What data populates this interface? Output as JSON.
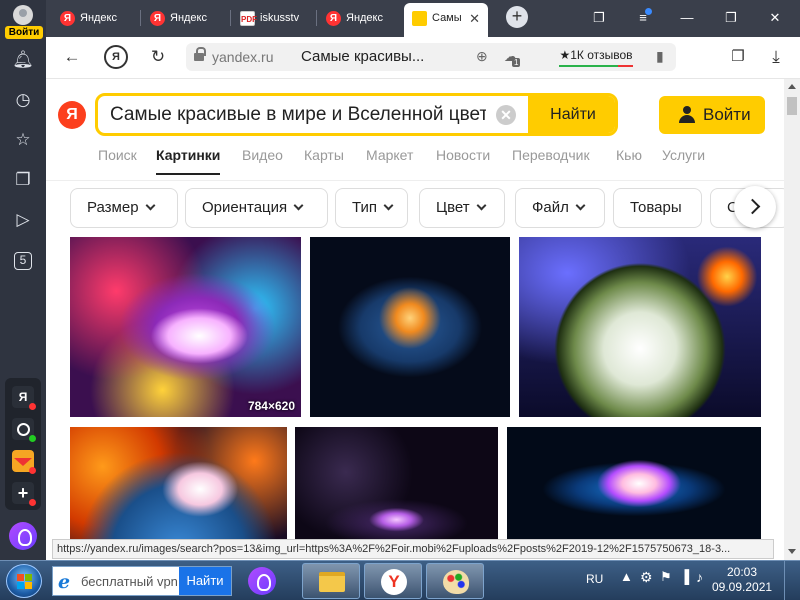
{
  "sidebar": {
    "login_label": "Войти",
    "icons": [
      "bell-icon",
      "history-icon",
      "star-icon",
      "collections-icon",
      "play-icon",
      "notes-icon"
    ],
    "notes_badge": "5",
    "apps": [
      {
        "name": "yandex-app",
        "label": "Я",
        "color": "#2a2f38"
      },
      {
        "name": "music-app",
        "label": "",
        "color": "#2a2f38"
      },
      {
        "name": "mail-app",
        "label": "",
        "color": "#f5a623"
      },
      {
        "name": "add-app",
        "label": "+",
        "color": "#2a2f38"
      }
    ]
  },
  "tabs": [
    {
      "title": "Яндекс",
      "favicon": "Я"
    },
    {
      "title": "Яндекс",
      "favicon": "Я"
    },
    {
      "title": "iskusstv",
      "favicon": "PDF"
    },
    {
      "title": "Яндекс",
      "favicon": "Я"
    },
    {
      "title": "Самы",
      "favicon": ""
    }
  ],
  "addressbar": {
    "domain": "yandex.ru",
    "page_title": "Самые красивы...",
    "reviews": "★1К отзывов",
    "protect_badge": "1"
  },
  "search": {
    "logo": "Я",
    "query": "Самые красивые в мире и Вселенной цветы",
    "clear": "✕",
    "find_label": "Найти",
    "login_label": "Войти"
  },
  "services": [
    {
      "label": "Поиск",
      "active": false
    },
    {
      "label": "Картинки",
      "active": true
    },
    {
      "label": "Видео",
      "active": false
    },
    {
      "label": "Карты",
      "active": false
    },
    {
      "label": "Маркет",
      "active": false
    },
    {
      "label": "Новости",
      "active": false
    },
    {
      "label": "Переводчик",
      "active": false
    },
    {
      "label": "Кью",
      "active": false
    },
    {
      "label": "Услуги",
      "active": false
    }
  ],
  "filters": [
    {
      "label": "Размер",
      "dropdown": true
    },
    {
      "label": "Ориентация",
      "dropdown": true
    },
    {
      "label": "Тип",
      "dropdown": true
    },
    {
      "label": "Цвет",
      "dropdown": true
    },
    {
      "label": "Файл",
      "dropdown": true
    },
    {
      "label": "Товары",
      "dropdown": false
    },
    {
      "label": "С",
      "dropdown": false
    }
  ],
  "images": [
    {
      "size": "784×620"
    }
  ],
  "status_url": "https://yandex.ru/images/search?pos=13&img_url=https%3A%2F%2Foir.mobi%2Fuploads%2Fposts%2F2019-12%2F1575750673_18-3...",
  "taskbar": {
    "search_placeholder": "бесплатный vpn",
    "search_button": "Найти",
    "lang": "RU",
    "time": "20:03",
    "date": "09.09.2021"
  },
  "colors": {
    "yandex_yellow": "#ffcc00",
    "yandex_red": "#fc3f1d",
    "sidebar_bg": "#2f3440",
    "tabbar_bg": "#3a3f4b"
  }
}
